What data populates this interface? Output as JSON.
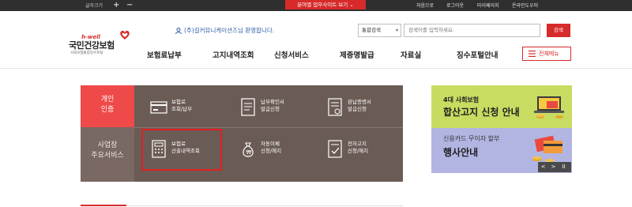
{
  "topbar": {
    "font_size_label": "글자크기",
    "font_plus": "+",
    "font_minus": "−",
    "biz_site_button": "분야별 업무사이트 보기",
    "links": [
      "처음으로",
      "로그아웃",
      "마이페이지",
      "온라인도우미"
    ]
  },
  "header": {
    "logo_tag": "h-well",
    "logo_name": "국민건강보험",
    "logo_sub": "사회보험통합징수포털",
    "welcome": "(주)길커뮤니케이션즈님 환영합니다.",
    "search_scope": "통합검색",
    "search_placeholder": "검색어를 입력하세요.",
    "search_button": "검색"
  },
  "gnb": {
    "items": [
      "보험료납부",
      "고지내역조회",
      "신청서비스",
      "제증명발급",
      "자료실",
      "징수포털안내"
    ],
    "all_menu": "전체메뉴"
  },
  "services": {
    "tabs": [
      "개인\n인증",
      "사업장\n주요서비스"
    ],
    "items": [
      {
        "line1": "보험료",
        "line2": "조회/납부",
        "icon": "card-icon"
      },
      {
        "line1": "납부확인서",
        "line2": "발급신청",
        "icon": "document-icon"
      },
      {
        "line1": "완납증명서",
        "line2": "발급신청",
        "icon": "certificate-icon"
      },
      {
        "line1": "보험료",
        "line2": "산출내역조회",
        "icon": "calculator-icon"
      },
      {
        "line1": "자동이체",
        "line2": "신청/해지",
        "icon": "money-bag-icon"
      },
      {
        "line1": "전자고지",
        "line2": "신청/해지",
        "icon": "e-notice-icon"
      }
    ]
  },
  "banner": {
    "slide1_line1": "4대 사회보험",
    "slide1_line2": "합산고지 신청 안내",
    "slide2_line1": "신용카드 무이자 할부",
    "slide2_line2": "행사안내",
    "controls": [
      "<",
      ">",
      "II"
    ]
  },
  "colors": {
    "accent": "#d72a2a",
    "panel": "#6b5b55",
    "tab_active": "#ef4a4a",
    "banner_green": "#c9dc62",
    "banner_purple": "#b2b5e2"
  }
}
